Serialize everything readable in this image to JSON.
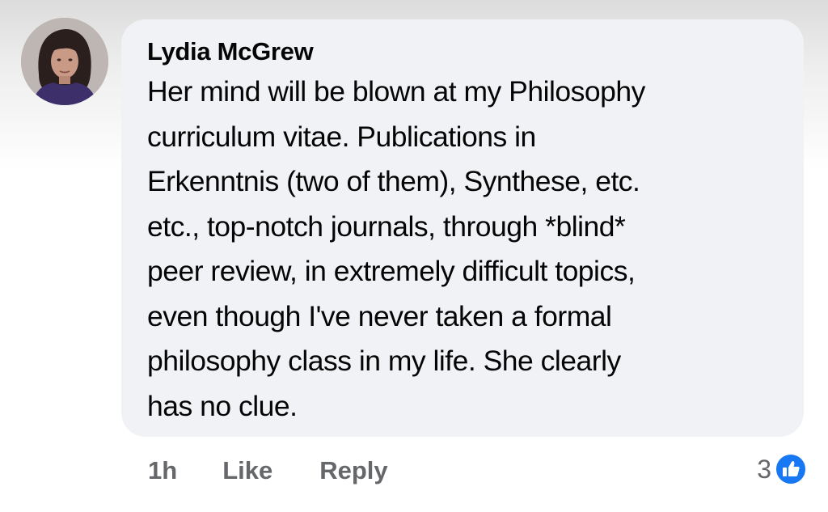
{
  "comment": {
    "author": "Lydia McGrew",
    "lines": [
      "Her mind will be blown at my Philosophy",
      "curriculum vitae. Publications in",
      "Erkenntnis (two of them), Synthese, etc.",
      "etc., top-notch journals, through *blind*",
      "peer review, in extremely difficult topics,",
      "even though I've never taken a formal",
      "philosophy class in my life. She clearly",
      "has no clue."
    ]
  },
  "actions": {
    "time": "1h",
    "like_label": "Like",
    "reply_label": "Reply"
  },
  "reactions": {
    "count": "3",
    "icon": "thumbs-up-icon",
    "color": "#1877f2"
  }
}
